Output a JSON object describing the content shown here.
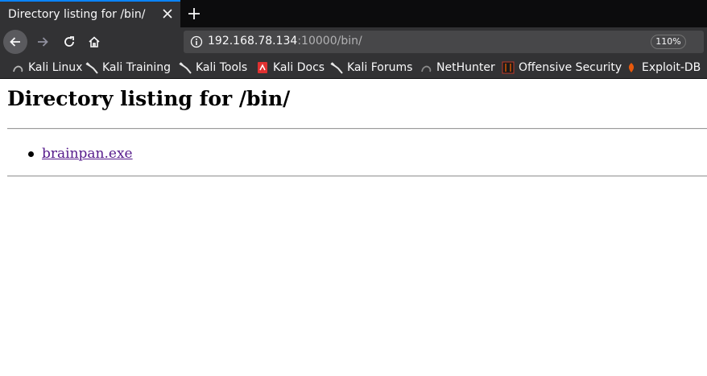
{
  "browser": {
    "tab": {
      "title": "Directory listing for /bin/"
    },
    "address": {
      "host": "192.168.78.134",
      "port_path": ":10000/bin/",
      "zoom": "110%"
    },
    "bookmarks": [
      {
        "label": "Kali Linux",
        "icon": "kali-dragon-icon"
      },
      {
        "label": "Kali Training",
        "icon": "kali-dragon-icon"
      },
      {
        "label": "Kali Tools",
        "icon": "kali-dragon-icon"
      },
      {
        "label": "Kali Docs",
        "icon": "kali-docs-icon"
      },
      {
        "label": "Kali Forums",
        "icon": "kali-dragon-icon"
      },
      {
        "label": "NetHunter",
        "icon": "kali-dragon-icon"
      },
      {
        "label": "Offensive Security",
        "icon": "offsec-icon"
      },
      {
        "label": "Exploit-DB",
        "icon": "exploit-db-icon"
      }
    ]
  },
  "page": {
    "heading": "Directory listing for /bin/",
    "files": [
      {
        "name": "brainpan.exe"
      }
    ]
  },
  "colors": {
    "chrome_dark": "#0c0c0d",
    "chrome": "#323234",
    "urlbar": "#474749",
    "tab_accent": "#0a84ff",
    "visited_link": "#551a8b"
  }
}
